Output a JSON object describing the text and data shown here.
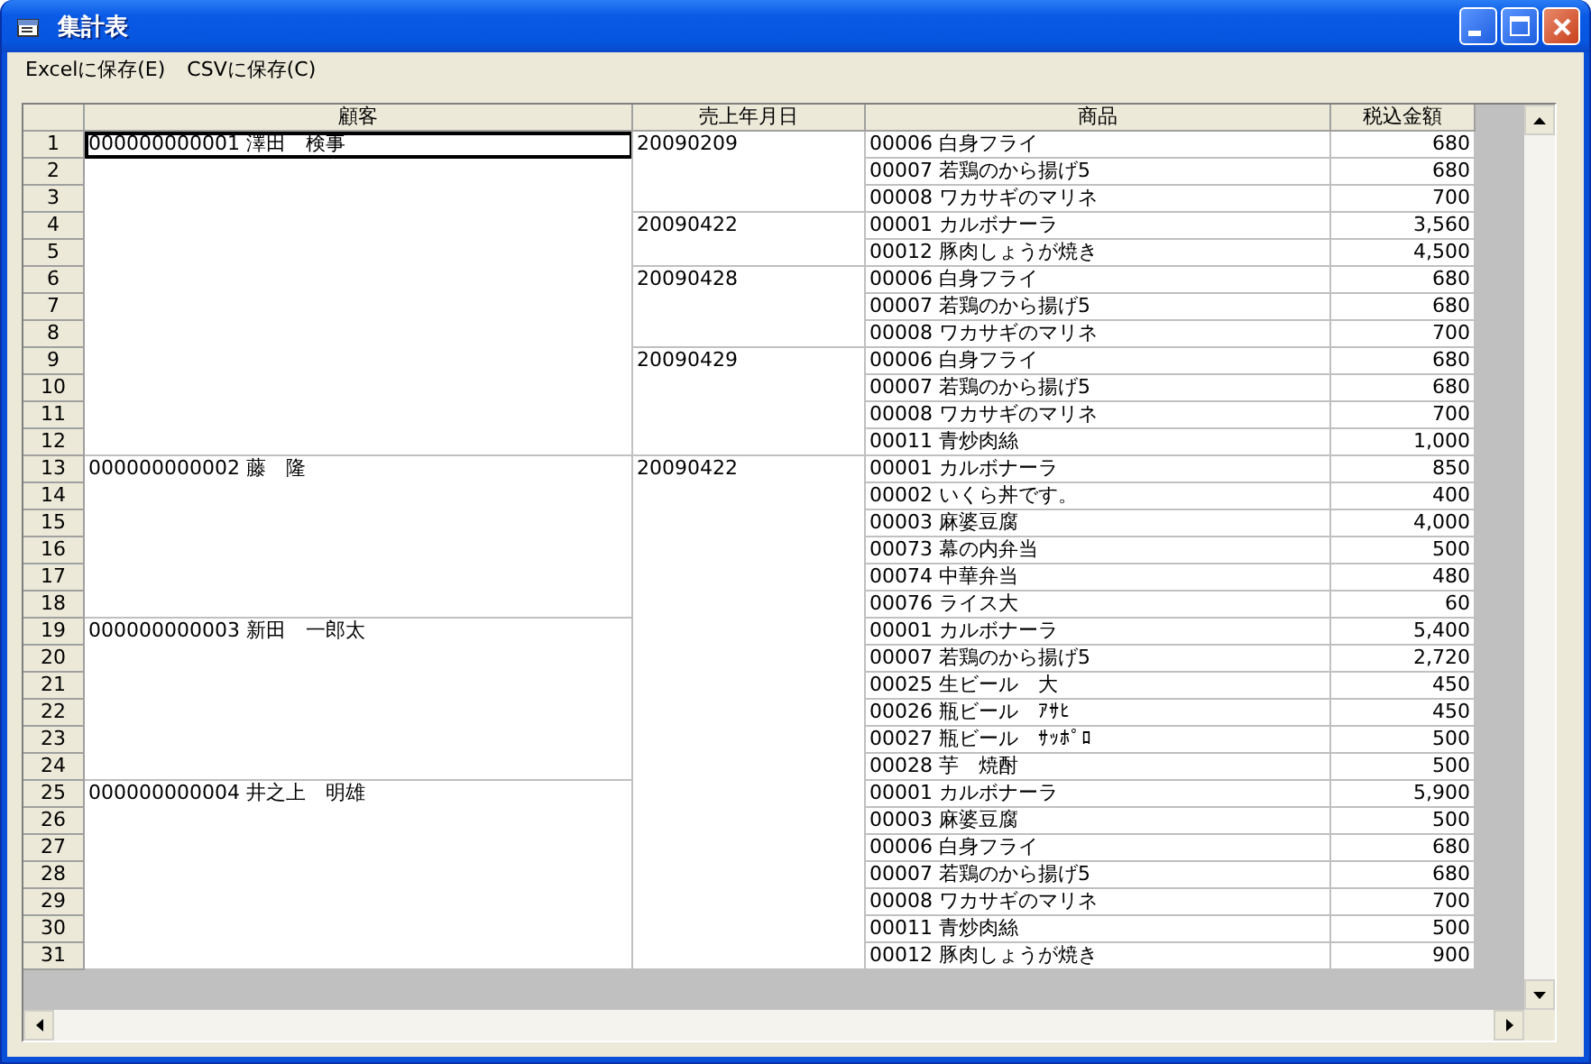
{
  "window": {
    "title": "集計表"
  },
  "menu": [
    {
      "label": "Excelに保存(E)"
    },
    {
      "label": "CSVに保存(C)"
    }
  ],
  "table": {
    "columns": [
      "顧客",
      "売上年月日",
      "商品",
      "税込金額"
    ],
    "rows": [
      {
        "row": "1",
        "customer": {
          "name": "000000000001 澤田　検事",
          "selected": true
        },
        "date": "20090209",
        "product": "00006 白身フライ",
        "amount": "680"
      },
      {
        "row": "2",
        "product": "00007 若鶏のから揚げ5",
        "amount": "680"
      },
      {
        "row": "3",
        "product": "00008 ワカサギのマリネ",
        "amount": "700"
      },
      {
        "row": "4",
        "date": "20090422",
        "product": "00001 カルボナーラ",
        "amount": "3,560"
      },
      {
        "row": "5",
        "product": "00012 豚肉しょうが焼き",
        "amount": "4,500"
      },
      {
        "row": "6",
        "date": "20090428",
        "product": "00006 白身フライ",
        "amount": "680"
      },
      {
        "row": "7",
        "product": "00007 若鶏のから揚げ5",
        "amount": "680"
      },
      {
        "row": "8",
        "product": "00008 ワカサギのマリネ",
        "amount": "700"
      },
      {
        "row": "9",
        "date": "20090429",
        "product": "00006 白身フライ",
        "amount": "680"
      },
      {
        "row": "10",
        "product": "00007 若鶏のから揚げ5",
        "amount": "680"
      },
      {
        "row": "11",
        "product": "00008 ワカサギのマリネ",
        "amount": "700"
      },
      {
        "row": "12",
        "product": "00011 青炒肉絲",
        "amount": "1,000"
      },
      {
        "row": "13",
        "customer": {
          "name": "000000000002 藤　隆",
          "selected": false
        },
        "date": "20090422",
        "product": "00001 カルボナーラ",
        "amount": "850"
      },
      {
        "row": "14",
        "product": "00002 いくら丼です。",
        "amount": "400"
      },
      {
        "row": "15",
        "product": "00003 麻婆豆腐",
        "amount": "4,000"
      },
      {
        "row": "16",
        "product": "00073 幕の内弁当",
        "amount": "500"
      },
      {
        "row": "17",
        "product": "00074 中華弁当",
        "amount": "480"
      },
      {
        "row": "18",
        "product": "00076 ライス大",
        "amount": "60"
      },
      {
        "row": "19",
        "customer": {
          "name": "000000000003 新田　一郎太",
          "selected": false
        },
        "product": "00001 カルボナーラ",
        "amount": "5,400"
      },
      {
        "row": "20",
        "product": "00007 若鶏のから揚げ5",
        "amount": "2,720"
      },
      {
        "row": "21",
        "product": "00025 生ビール　大",
        "amount": "450"
      },
      {
        "row": "22",
        "product": "00026 瓶ビール　ｱｻﾋ",
        "amount": "450"
      },
      {
        "row": "23",
        "product": "00027 瓶ビール　ｻｯﾎﾟﾛ",
        "amount": "500"
      },
      {
        "row": "24",
        "product": "00028 芋　焼酎",
        "amount": "500"
      },
      {
        "row": "25",
        "customer": {
          "name": "000000000004 井之上　明雄",
          "selected": false
        },
        "product": "00001 カルボナーラ",
        "amount": "5,900"
      },
      {
        "row": "26",
        "product": "00003 麻婆豆腐",
        "amount": "500"
      },
      {
        "row": "27",
        "product": "00006 白身フライ",
        "amount": "680"
      },
      {
        "row": "28",
        "product": "00007 若鶏のから揚げ5",
        "amount": "680"
      },
      {
        "row": "29",
        "product": "00008 ワカサギのマリネ",
        "amount": "700"
      },
      {
        "row": "30",
        "product": "00011 青炒肉絲",
        "amount": "500"
      },
      {
        "row": "31",
        "product": "00012 豚肉しょうが焼き",
        "amount": "900"
      }
    ]
  }
}
